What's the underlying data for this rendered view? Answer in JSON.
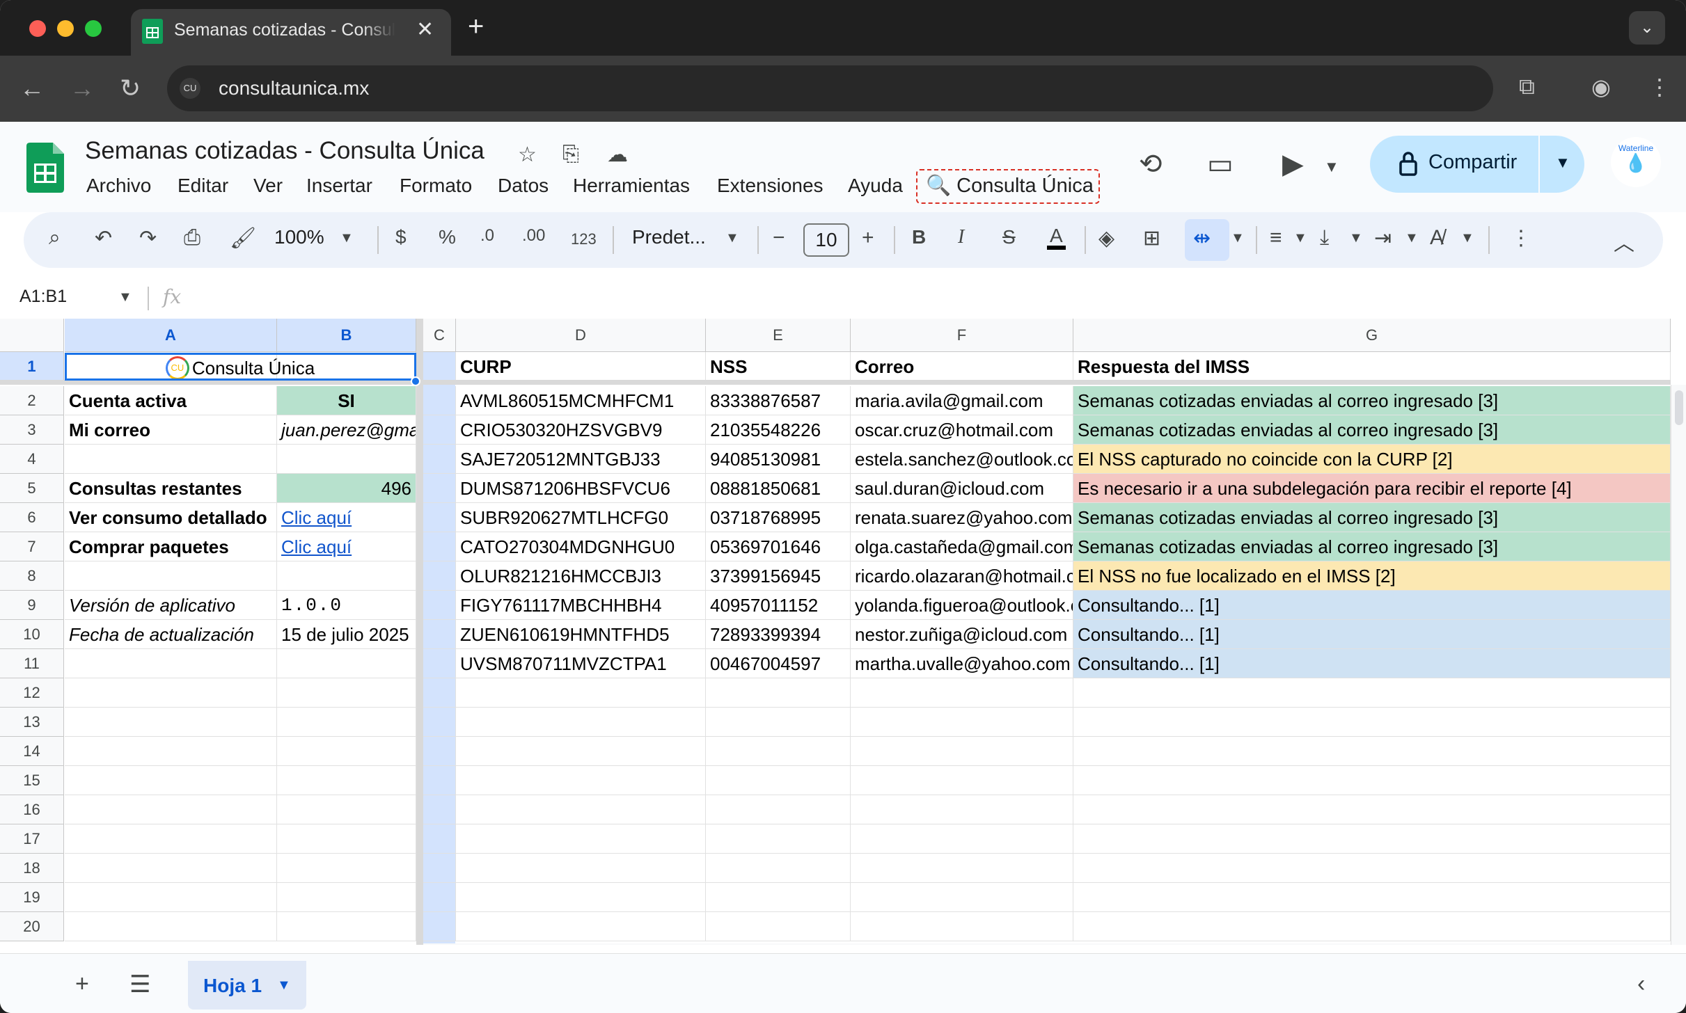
{
  "browser": {
    "tab_title": "Semanas cotizadas - Consulta Única",
    "new_tab": "+",
    "close_tab": "✕",
    "url": "consultaunica.mx",
    "site_icon": "CU"
  },
  "app": {
    "doc_title": "Semanas cotizadas - Consulta Única",
    "menus": [
      "Archivo",
      "Editar",
      "Ver",
      "Insertar",
      "Formato",
      "Datos",
      "Herramientas",
      "Extensiones",
      "Ayuda"
    ],
    "addon_menu": "🔍 Consulta Única",
    "share_label": "Compartir",
    "avatar_text": "Waterline"
  },
  "toolbar": {
    "zoom": "100%",
    "currency": "$",
    "percent": "%",
    "dec_less": ".0",
    "dec_more": ".00",
    "number_format": "123",
    "font": "Predet...",
    "font_size": "10",
    "bold": "B",
    "italic": "I",
    "strike": "S",
    "text_color": "A"
  },
  "formula_bar": {
    "name_box": "A1:B1",
    "fx": "fx",
    "value": ""
  },
  "grid": {
    "columns": [
      "A",
      "B",
      "C",
      "D",
      "E",
      "F",
      "G"
    ],
    "rows": [
      "1",
      "2",
      "3",
      "4",
      "5",
      "6",
      "7",
      "8",
      "9",
      "10",
      "11",
      "12",
      "13",
      "14",
      "15",
      "16",
      "17",
      "18",
      "19",
      "20"
    ],
    "left": {
      "title": "Consulta Única",
      "rows": [
        {
          "label": "Cuenta activa",
          "value": "SI"
        },
        {
          "label": "Mi correo",
          "value": "juan.perez@gmail.com"
        },
        {
          "label": "",
          "value": ""
        },
        {
          "label": "Consultas restantes",
          "value": "496"
        },
        {
          "label": "Ver consumo detallado",
          "value": "Clic aquí"
        },
        {
          "label": "Comprar paquetes",
          "value": "Clic aquí"
        },
        {
          "label": "",
          "value": ""
        },
        {
          "label": "Versión de aplicativo",
          "value": "1.0.0"
        },
        {
          "label": "Fecha de actualización",
          "value": "15 de julio 2025"
        }
      ]
    },
    "headers": {
      "curp": "CURP",
      "nss": "NSS",
      "correo": "Correo",
      "respuesta": "Respuesta del IMSS"
    },
    "records": [
      {
        "curp": "AVML860515MCMHFCM1",
        "nss": "83338876587",
        "correo": "maria.avila@gmail.com",
        "respuesta": "Semanas cotizadas enviadas al correo ingresado [3]",
        "status": "green"
      },
      {
        "curp": "CRIO530320HZSVGBV9",
        "nss": "21035548226",
        "correo": "oscar.cruz@hotmail.com",
        "respuesta": "Semanas cotizadas enviadas al correo ingresado [3]",
        "status": "green"
      },
      {
        "curp": "SAJE720512MNTGBJ33",
        "nss": "94085130981",
        "correo": "estela.sanchez@outlook.com",
        "respuesta": "El NSS capturado no coincide con la CURP [2]",
        "status": "yellow"
      },
      {
        "curp": "DUMS871206HBSFVCU6",
        "nss": "08881850681",
        "correo": "saul.duran@icloud.com",
        "respuesta": "Es necesario ir a una subdelegación para recibir el reporte [4]",
        "status": "red"
      },
      {
        "curp": "SUBR920627MTLHCFG0",
        "nss": "03718768995",
        "correo": "renata.suarez@yahoo.com",
        "respuesta": "Semanas cotizadas enviadas al correo ingresado [3]",
        "status": "green"
      },
      {
        "curp": "CATO270304MDGNHGU0",
        "nss": "05369701646",
        "correo": "olga.castañeda@gmail.com",
        "respuesta": "Semanas cotizadas enviadas al correo ingresado [3]",
        "status": "green"
      },
      {
        "curp": "OLUR821216HMCCBJI3",
        "nss": "37399156945",
        "correo": "ricardo.olazaran@hotmail.com",
        "respuesta": "El NSS no fue localizado en el IMSS [2]",
        "status": "yellow"
      },
      {
        "curp": "FIGY761117MBCHHBH4",
        "nss": "40957011152",
        "correo": "yolanda.figueroa@outlook.com",
        "respuesta": "Consultando... [1]",
        "status": "blue"
      },
      {
        "curp": "ZUEN610619HMNTFHD5",
        "nss": "72893399394",
        "correo": "nestor.zuñiga@icloud.com",
        "respuesta": "Consultando... [1]",
        "status": "blue"
      },
      {
        "curp": "UVSM870711MVZCTPA1",
        "nss": "00467004597",
        "correo": "martha.uvalle@yahoo.com",
        "respuesta": "Consultando... [1]",
        "status": "blue"
      }
    ]
  },
  "sheets": {
    "add": "+",
    "list": "☰",
    "active_tab": "Hoja 1"
  },
  "colors": {
    "green": "#b7e1cd",
    "yellow": "#fce8b2",
    "red": "#f4c7c3",
    "blue": "#cfe2f3",
    "accent": "#1a73e8",
    "share_bg": "#c2e7ff"
  }
}
